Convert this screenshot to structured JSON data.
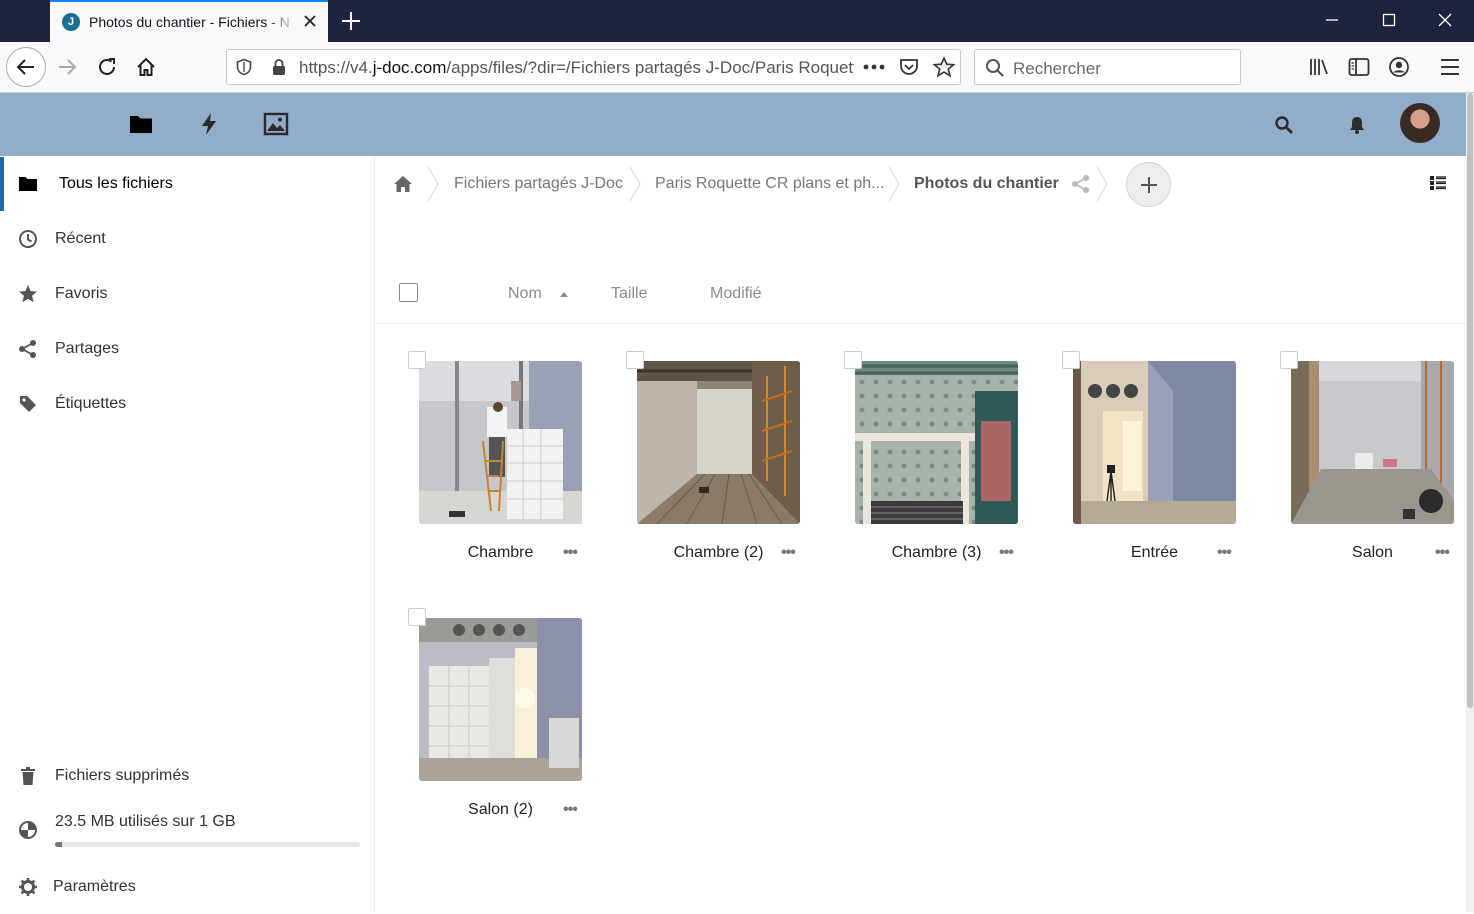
{
  "browser": {
    "tab_title": "Photos du chantier - Fichiers - N",
    "favicon_letter": "J",
    "url_prefix": "https://v4.",
    "url_host": "j-doc.com",
    "url_path": "/apps/files/?dir=/Fichiers partagés J-Doc/Paris Roquette CR plans et photos",
    "search_placeholder": "Rechercher"
  },
  "sidebar": {
    "items": [
      {
        "label": "Tous les fichiers",
        "icon": "folder-icon"
      },
      {
        "label": "Récent",
        "icon": "clock-icon"
      },
      {
        "label": "Favoris",
        "icon": "star-icon"
      },
      {
        "label": "Partages",
        "icon": "share-icon"
      },
      {
        "label": "Étiquettes",
        "icon": "tag-icon"
      }
    ],
    "trash_label": "Fichiers supprimés",
    "quota_label": "23.5 MB utilisés sur 1 GB",
    "quota_fraction": 0.023,
    "settings_label": "Paramètres"
  },
  "breadcrumb": {
    "items": [
      "Fichiers partagés J-Doc",
      "Paris Roquette CR plans et ph...",
      "Photos du chantier"
    ]
  },
  "columns": {
    "name": "Nom",
    "size": "Taille",
    "modified": "Modifié"
  },
  "files": [
    {
      "name": "Chambre"
    },
    {
      "name": "Chambre (2)"
    },
    {
      "name": "Chambre (3)"
    },
    {
      "name": "Entrée"
    },
    {
      "name": "Salon"
    },
    {
      "name": "Salon (2)"
    }
  ],
  "more_glyph": "•••",
  "colors": {
    "header": "#91adc9",
    "accent": "#1f6aa5",
    "tabbar": "#202340"
  }
}
